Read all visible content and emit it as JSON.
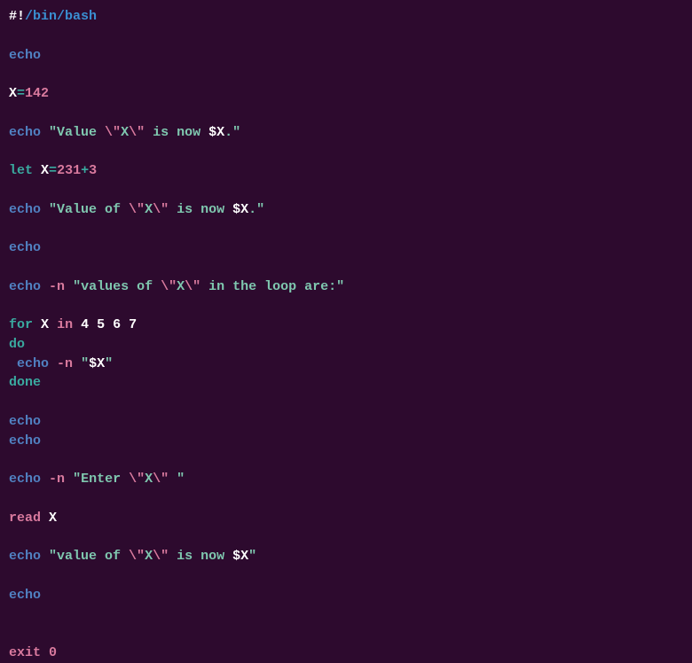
{
  "code": {
    "lines": [
      {
        "tokens": [
          [
            "shebang-hash",
            "#!"
          ],
          [
            "shebang-path",
            "/bin/bash"
          ]
        ]
      },
      {
        "tokens": []
      },
      {
        "tokens": [
          [
            "echo",
            "echo"
          ]
        ]
      },
      {
        "tokens": []
      },
      {
        "tokens": [
          [
            "var",
            "X"
          ],
          [
            "eq",
            "="
          ],
          [
            "num",
            "142"
          ]
        ]
      },
      {
        "tokens": []
      },
      {
        "tokens": [
          [
            "echo",
            "echo"
          ],
          [
            "space",
            " "
          ],
          [
            "string",
            "\"Value "
          ],
          [
            "escape",
            "\\\""
          ],
          [
            "string",
            "X"
          ],
          [
            "escape",
            "\\\""
          ],
          [
            "string",
            " is now "
          ],
          [
            "dollar",
            "$X"
          ],
          [
            "string",
            ".\""
          ]
        ]
      },
      {
        "tokens": []
      },
      {
        "tokens": [
          [
            "let",
            "let"
          ],
          [
            "space",
            " "
          ],
          [
            "var",
            "X"
          ],
          [
            "eq",
            "="
          ],
          [
            "num",
            "231"
          ],
          [
            "plus",
            "+"
          ],
          [
            "num",
            "3"
          ]
        ]
      },
      {
        "tokens": []
      },
      {
        "tokens": [
          [
            "echo",
            "echo"
          ],
          [
            "space",
            " "
          ],
          [
            "string",
            "\"Value of "
          ],
          [
            "escape",
            "\\\""
          ],
          [
            "string",
            "X"
          ],
          [
            "escape",
            "\\\""
          ],
          [
            "string",
            " is now "
          ],
          [
            "dollar",
            "$X"
          ],
          [
            "string",
            ".\""
          ]
        ]
      },
      {
        "tokens": []
      },
      {
        "tokens": [
          [
            "echo",
            "echo"
          ]
        ]
      },
      {
        "tokens": []
      },
      {
        "tokens": [
          [
            "echo",
            "echo"
          ],
          [
            "space",
            " "
          ],
          [
            "flag",
            "-n"
          ],
          [
            "space",
            " "
          ],
          [
            "string",
            "\"values of "
          ],
          [
            "escape",
            "\\\""
          ],
          [
            "string",
            "X"
          ],
          [
            "escape",
            "\\\""
          ],
          [
            "string",
            " in the loop are:\""
          ]
        ]
      },
      {
        "tokens": []
      },
      {
        "tokens": [
          [
            "for",
            "for"
          ],
          [
            "space",
            " "
          ],
          [
            "var",
            "X"
          ],
          [
            "space",
            " "
          ],
          [
            "in",
            "in"
          ],
          [
            "space",
            " "
          ],
          [
            "var",
            "4 5 6 7"
          ]
        ]
      },
      {
        "tokens": [
          [
            "do",
            "do"
          ]
        ]
      },
      {
        "tokens": [
          [
            "space",
            " "
          ],
          [
            "echo",
            "echo"
          ],
          [
            "space",
            " "
          ],
          [
            "flag",
            "-n"
          ],
          [
            "space",
            " "
          ],
          [
            "string",
            "\""
          ],
          [
            "dollar",
            "$X"
          ],
          [
            "string",
            "\""
          ]
        ]
      },
      {
        "tokens": [
          [
            "done",
            "done"
          ]
        ]
      },
      {
        "tokens": []
      },
      {
        "tokens": [
          [
            "echo",
            "echo"
          ]
        ]
      },
      {
        "tokens": [
          [
            "echo",
            "echo"
          ]
        ]
      },
      {
        "tokens": []
      },
      {
        "tokens": [
          [
            "echo",
            "echo"
          ],
          [
            "space",
            " "
          ],
          [
            "flag",
            "-n"
          ],
          [
            "space",
            " "
          ],
          [
            "string",
            "\"Enter "
          ],
          [
            "escape",
            "\\\""
          ],
          [
            "string",
            "X"
          ],
          [
            "escape",
            "\\\""
          ],
          [
            "string",
            " \""
          ]
        ]
      },
      {
        "tokens": []
      },
      {
        "tokens": [
          [
            "read",
            "read"
          ],
          [
            "space",
            " "
          ],
          [
            "var",
            "X"
          ]
        ]
      },
      {
        "tokens": []
      },
      {
        "tokens": [
          [
            "echo",
            "echo"
          ],
          [
            "space",
            " "
          ],
          [
            "string",
            "\"value of "
          ],
          [
            "escape",
            "\\\""
          ],
          [
            "string",
            "X"
          ],
          [
            "escape",
            "\\\""
          ],
          [
            "string",
            " is now "
          ],
          [
            "dollar",
            "$X"
          ],
          [
            "string",
            "\""
          ]
        ]
      },
      {
        "tokens": []
      },
      {
        "tokens": [
          [
            "echo",
            "echo"
          ]
        ]
      },
      {
        "tokens": []
      },
      {
        "tokens": []
      },
      {
        "tokens": [
          [
            "exit",
            "exit"
          ],
          [
            "space",
            " "
          ],
          [
            "num",
            "0"
          ]
        ]
      }
    ]
  }
}
